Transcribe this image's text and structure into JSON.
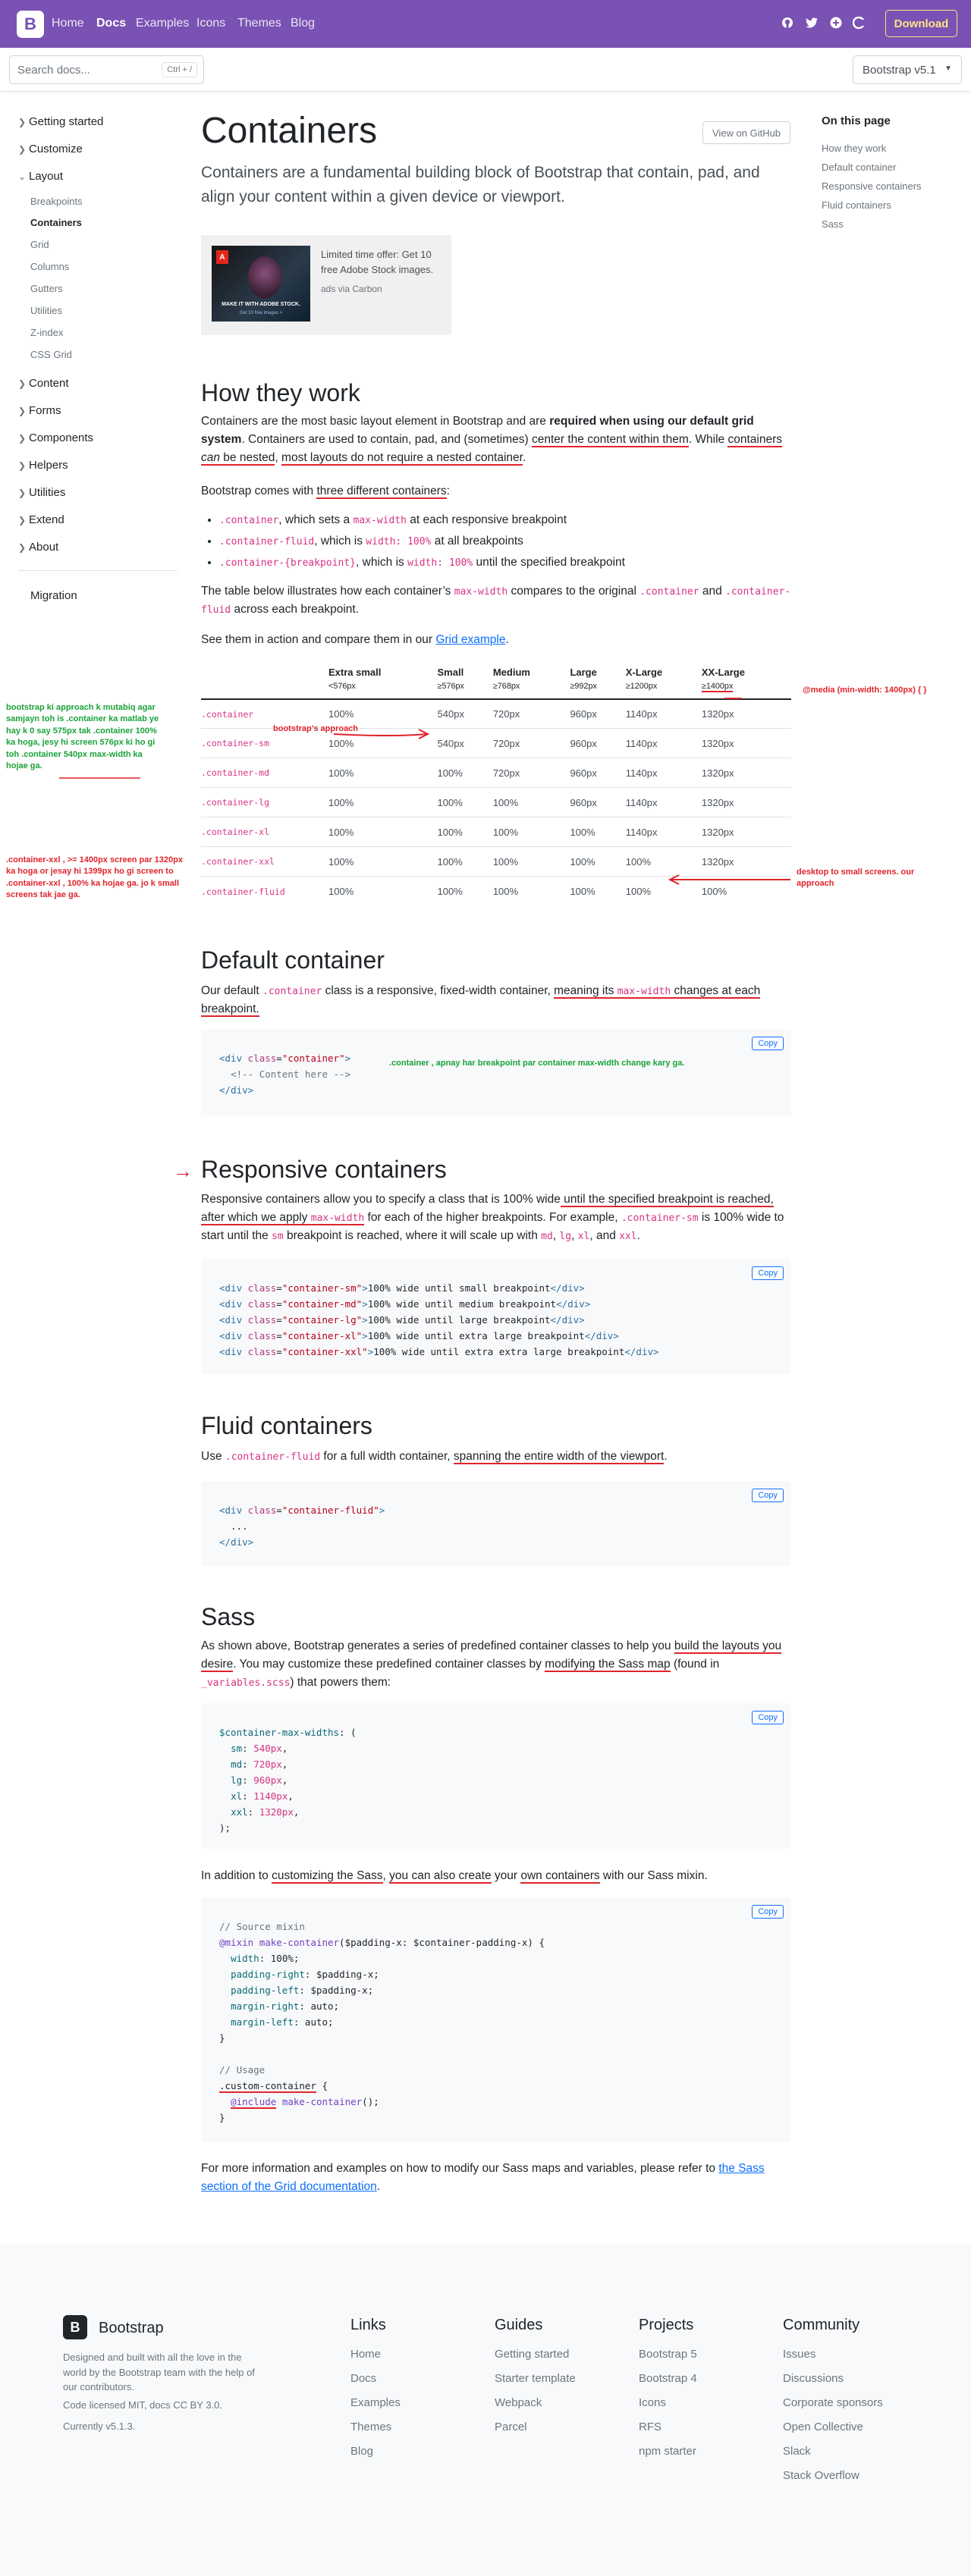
{
  "navbar": {
    "brand": "B",
    "links": [
      "Home",
      "Docs",
      "Examples",
      "Icons",
      "Themes",
      "Blog"
    ],
    "icons": [
      "github-icon",
      "twitter-icon",
      "slack-icon",
      "open-collective-icon"
    ],
    "download_label": "Download"
  },
  "subnav": {
    "search_placeholder": "Search docs...",
    "search_shortcut": "Ctrl + /",
    "version": "Bootstrap v5.1"
  },
  "sidebar": {
    "groups": [
      "Getting started",
      "Customize",
      "Layout",
      "Content",
      "Forms",
      "Components",
      "Helpers",
      "Utilities",
      "Extend",
      "About"
    ],
    "layout_items": [
      "Breakpoints",
      "Containers",
      "Grid",
      "Columns",
      "Gutters",
      "Utilities",
      "Z-index",
      "CSS Grid"
    ],
    "migration": "Migration"
  },
  "main": {
    "title": "Containers",
    "github_label": "View on GitHub",
    "lead": "Containers are a fundamental building block of Bootstrap that contain, pad, and align your content within a given device or viewport.",
    "ad": {
      "text": "Limited time offer: Get 10 free Adobe Stock images.",
      "via": "ads via Carbon",
      "img_caption": "MAKE IT WITH ADOBE STOCK.",
      "img_cta": "Get 10 free images >",
      "img_logo": "A"
    },
    "how": {
      "heading": "How they work",
      "p1": [
        "Containers are the most basic layout element in Bootstrap and are ",
        "required when using our default grid system",
        ". Containers are used to contain, pad, and (sometimes) ",
        "center the content within them",
        ". While ",
        "containers ",
        "can",
        " be nested",
        ", ",
        "most layouts do not require a nested container",
        "."
      ],
      "p2_pre": "Bootstrap comes with ",
      "p2_ul": "three different containers",
      "p2_post": ":",
      "bullets": [
        {
          "code": ".container",
          "t1": ", which sets a ",
          "code2": "max-width",
          "t2": " at each responsive breakpoint"
        },
        {
          "code": ".container-fluid",
          "t1": ", which is ",
          "code2": "width: 100%",
          "t2": " at all breakpoints"
        },
        {
          "code": ".container-{breakpoint}",
          "t1": ", which is ",
          "code2": "width: 100%",
          "t2": " until the specified breakpoint"
        }
      ],
      "p3_a": "The table below illustrates how each container’s ",
      "p3_code1": "max-width",
      "p3_b": " compares to the original ",
      "p3_code2": ".container",
      "p3_c": " and ",
      "p3_code3": ".container-fluid",
      "p3_d": " across each breakpoint.",
      "p4_a": "See them in action and compare them in our ",
      "p4_link": "Grid example",
      "p4_b": "."
    },
    "table": {
      "headers": [
        {
          "name": "",
          "sub": ""
        },
        {
          "name": "Extra small",
          "sub": "<576px"
        },
        {
          "name": "Small",
          "sub": "≥576px"
        },
        {
          "name": "Medium",
          "sub": "≥768px"
        },
        {
          "name": "Large",
          "sub": "≥992px"
        },
        {
          "name": "X-Large",
          "sub": "≥1200px"
        },
        {
          "name": "XX-Large",
          "sub": "≥1400px"
        }
      ],
      "rows": [
        [
          ".container",
          "100%",
          "540px",
          "720px",
          "960px",
          "1140px",
          "1320px"
        ],
        [
          ".container-sm",
          "100%",
          "540px",
          "720px",
          "960px",
          "1140px",
          "1320px"
        ],
        [
          ".container-md",
          "100%",
          "100%",
          "720px",
          "960px",
          "1140px",
          "1320px"
        ],
        [
          ".container-lg",
          "100%",
          "100%",
          "100%",
          "960px",
          "1140px",
          "1320px"
        ],
        [
          ".container-xl",
          "100%",
          "100%",
          "100%",
          "100%",
          "1140px",
          "1320px"
        ],
        [
          ".container-xxl",
          "100%",
          "100%",
          "100%",
          "100%",
          "100%",
          "1320px"
        ],
        [
          ".container-fluid",
          "100%",
          "100%",
          "100%",
          "100%",
          "100%",
          "100%"
        ]
      ]
    },
    "default": {
      "heading": "Default container",
      "p_a": "Our default ",
      "p_code": ".container",
      "p_b": " class is a responsive, fixed-width container, ",
      "p_ul1": "meaning its ",
      "p_code2": "max-width",
      "p_ul2": " changes at each breakpoint.",
      "code": "<div class=\"container\">\n  <!-- Content here -->\n</div>"
    },
    "responsive": {
      "heading": "Responsive containers",
      "p_a": "Responsive containers allow you to specify a class that is 100% wide",
      "p_ul": " until the specified breakpoint is reached, after which we apply ",
      "p_code": "max-width",
      "p_b": " for each of the higher breakpoints. For example, ",
      "p_code2": ".container-sm",
      "p_c": " is 100% wide to start until the ",
      "p_code3": "sm",
      "p_d": " breakpoint is reached, where it will scale up with ",
      "p_code4": "md",
      "p_e": ", ",
      "p_code5": "lg",
      "p_f": ", ",
      "p_code6": "xl",
      "p_g": ", and ",
      "p_code7": "xxl",
      "p_h": ".",
      "code_lines": [
        {
          "cls": "container-sm",
          "text": "100% wide until small breakpoint"
        },
        {
          "cls": "container-md",
          "text": "100% wide until medium breakpoint"
        },
        {
          "cls": "container-lg",
          "text": "100% wide until large breakpoint"
        },
        {
          "cls": "container-xl",
          "text": "100% wide until extra large breakpoint"
        },
        {
          "cls": "container-xxl",
          "text": "100% wide until extra extra large breakpoint"
        }
      ]
    },
    "fluid": {
      "heading": "Fluid containers",
      "p_a": "Use ",
      "p_code": ".container-fluid",
      "p_b": " for a full width container, ",
      "p_ul": "spanning the entire width of the viewport",
      "p_c": ".",
      "code": "<div class=\"container-fluid\">\n  ...\n</div>"
    },
    "sass": {
      "heading": "Sass",
      "p1_a": "As shown above, Bootstrap generates a series of predefined container classes to help you ",
      "p1_ul": "build the layouts you desire",
      "p1_b": ". You may customize these predefined container classes by ",
      "p1_ul2": "modifying the Sass map",
      "p1_c": " (found in ",
      "p1_code": "_variables.scss",
      "p1_d": ") that powers them:",
      "map_var": "$container-max-widths",
      "map": [
        [
          "sm",
          "540px"
        ],
        [
          "md",
          "720px"
        ],
        [
          "lg",
          "960px"
        ],
        [
          "xl",
          "1140px"
        ],
        [
          "xxl",
          "1320px"
        ]
      ],
      "p2_a": "In addition to ",
      "p2_ul": "customizing the Sass",
      "p2_b": ", ",
      "p2_ul2": "you can also create",
      "p2_c": " your ",
      "p2_ul3": "own containers",
      "p2_d": " with our Sass mixin.",
      "mixin_comment": "// Source mixin",
      "mixin_name": "make-container",
      "mixin_args": "$padding-x: $container-padding-x",
      "mixin_props": [
        [
          "width",
          "100%"
        ],
        [
          "padding-right",
          "$padding-x"
        ],
        [
          "padding-left",
          "$padding-x"
        ],
        [
          "margin-right",
          "auto"
        ],
        [
          "margin-left",
          "auto"
        ]
      ],
      "usage_comment": "// Usage",
      "usage_sel": ".custom-container",
      "usage_include": "@include",
      "p3_a": "For more information and examples on how to modify our Sass maps and variables, please refer to ",
      "p3_link": "the Sass section of the Grid documentation",
      "p3_b": "."
    },
    "copy_label": "Copy"
  },
  "toc": {
    "title": "On this page",
    "items": [
      "How they work",
      "Default container",
      "Responsive containers",
      "Fluid containers",
      "Sass"
    ]
  },
  "annotations": {
    "left_green": "bootstrap ki approach k mutabiq agar samjayn toh is .container ka matlab ye hay k 0 say 575px tak .container 100% ka hoga, jesy hi screen 576px ki ho gi toh .container 540px max-width ka hojae ga.",
    "left_red": ".container-xxl , >= 1400px screen par 1320px ka hoga or jesay hi 1399px ho gi screen to .container-xxl , 100% ka hojae ga. jo k small screens tak jae ga.",
    "bootstraps_approach": "bootstrap's approach",
    "media_query": "@media (min-width: 1400px) { }",
    "desktop_note": "desktop to small screens. our approach",
    "default_note": ".container , apnay har breakpoint par container max-width change kary ga.",
    "arrow": "→"
  },
  "footer": {
    "brand": "Bootstrap",
    "logo": "B",
    "desc": "Designed and built with all the love in the world by the Bootstrap team with the help of our contributors.",
    "license": "Code licensed MIT, docs CC BY 3.0.",
    "version": "Currently v5.1.3.",
    "columns": [
      {
        "title": "Links",
        "items": [
          "Home",
          "Docs",
          "Examples",
          "Themes",
          "Blog"
        ]
      },
      {
        "title": "Guides",
        "items": [
          "Getting started",
          "Starter template",
          "Webpack",
          "Parcel"
        ]
      },
      {
        "title": "Projects",
        "items": [
          "Bootstrap 5",
          "Bootstrap 4",
          "Icons",
          "RFS",
          "npm starter"
        ]
      },
      {
        "title": "Community",
        "items": [
          "Issues",
          "Discussions",
          "Corporate sponsors",
          "Open Collective",
          "Slack",
          "Stack Overflow"
        ]
      }
    ]
  },
  "colors": {
    "brand": "#7952b3",
    "download": "#ffe484",
    "code": "#d63384",
    "link": "#0d6efd",
    "annotation_red": "#e0242c",
    "annotation_green": "#1aa33a"
  }
}
